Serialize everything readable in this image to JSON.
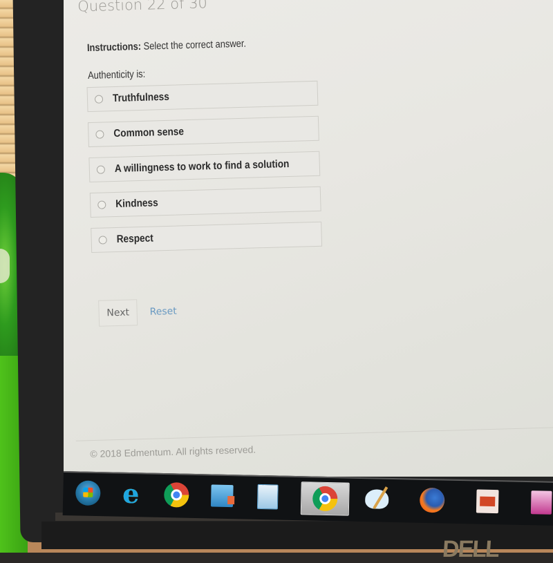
{
  "page": {
    "question_counter": "Question 22 of 30",
    "instructions_label": "Instructions:",
    "instructions_text": " Select the correct answer.",
    "question": "Authenticity is:",
    "options": [
      {
        "label": "Truthfulness",
        "selected": false
      },
      {
        "label": "Common sense",
        "selected": false
      },
      {
        "label": "A willingness to work to find a solution",
        "selected": false
      },
      {
        "label": "Kindness",
        "selected": false
      },
      {
        "label": "Respect",
        "selected": false
      }
    ],
    "next_label": "Next",
    "reset_label": "Reset",
    "footer": "© 2018 Edmentum. All rights reserved."
  },
  "taskbar": {
    "items": [
      {
        "icon": "windows-start-icon",
        "active": false
      },
      {
        "icon": "internet-explorer-icon",
        "active": false
      },
      {
        "icon": "chrome-icon",
        "active": false
      },
      {
        "icon": "remote-desktop-icon",
        "active": false
      },
      {
        "icon": "calculator-icon",
        "active": false
      },
      {
        "icon": "chrome-icon",
        "active": true
      },
      {
        "icon": "paint-icon",
        "active": false
      },
      {
        "icon": "firefox-icon",
        "active": false
      },
      {
        "icon": "powerpoint-icon",
        "active": false
      },
      {
        "icon": "access-icon",
        "active": false
      }
    ]
  },
  "monitor": {
    "brand": "DELL"
  },
  "colors": {
    "reset_link": "#6a9ac2",
    "taskbar": "#101214"
  }
}
